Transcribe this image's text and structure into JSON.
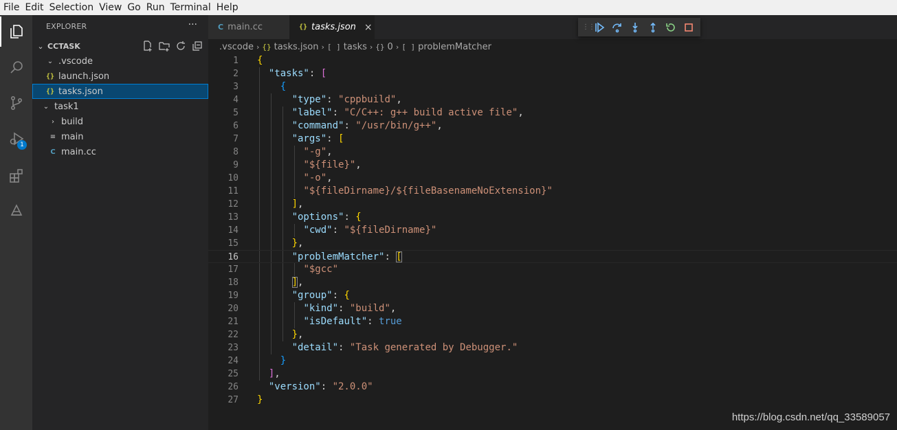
{
  "menu": [
    "File",
    "Edit",
    "Selection",
    "View",
    "Go",
    "Run",
    "Terminal",
    "Help"
  ],
  "activity_bar": {
    "icons": [
      "explorer-icon",
      "search-icon",
      "source-control-icon",
      "run-debug-icon",
      "extensions-icon",
      "remote-icon"
    ],
    "debug_badge": "1"
  },
  "sidebar": {
    "title": "EXPLORER",
    "more": "···",
    "section": "CCTASK",
    "tree": [
      {
        "label": ".vscode",
        "type": "folder-open",
        "depth": 1
      },
      {
        "label": "launch.json",
        "type": "json",
        "depth": 2
      },
      {
        "label": "tasks.json",
        "type": "json",
        "depth": 2,
        "selected": true
      },
      {
        "label": "task1",
        "type": "folder-open",
        "depth": 1
      },
      {
        "label": "build",
        "type": "folder-closed",
        "depth": 2
      },
      {
        "label": "main",
        "type": "file",
        "depth": 2
      },
      {
        "label": "main.cc",
        "type": "cpp",
        "depth": 2
      }
    ]
  },
  "tabs": [
    {
      "label": "main.cc",
      "active": false,
      "icon": "cpp-icon"
    },
    {
      "label": "tasks.json",
      "active": true,
      "icon": "json-icon",
      "close": "×"
    }
  ],
  "breadcrumb": {
    "folder": ".vscode",
    "file": "tasks.json",
    "item1": "tasks",
    "item2": "0",
    "item3": "problemMatcher"
  },
  "editor": {
    "current_line": 16,
    "lines": [
      {
        "n": "1"
      },
      {
        "n": "2"
      },
      {
        "n": "3"
      },
      {
        "n": "4"
      },
      {
        "n": "5"
      },
      {
        "n": "6"
      },
      {
        "n": "7"
      },
      {
        "n": "8"
      },
      {
        "n": "9"
      },
      {
        "n": "10"
      },
      {
        "n": "11"
      },
      {
        "n": "12"
      },
      {
        "n": "13"
      },
      {
        "n": "14"
      },
      {
        "n": "15"
      },
      {
        "n": "16"
      },
      {
        "n": "17"
      },
      {
        "n": "18"
      },
      {
        "n": "19"
      },
      {
        "n": "20"
      },
      {
        "n": "21"
      },
      {
        "n": "22"
      },
      {
        "n": "23"
      },
      {
        "n": "24"
      },
      {
        "n": "25"
      },
      {
        "n": "26"
      },
      {
        "n": "27"
      }
    ],
    "code": {
      "l1_open": "{",
      "tasks_key": "\"tasks\"",
      "type_key": "\"type\"",
      "type_val": "\"cppbuild\"",
      "label_key": "\"label\"",
      "label_val": "\"C/C++: g++ build active file\"",
      "command_key": "\"command\"",
      "command_val": "\"/usr/bin/g++\"",
      "args_key": "\"args\"",
      "arg1": "\"-g\"",
      "arg2": "\"${file}\"",
      "arg3": "\"-o\"",
      "arg4": "\"${fileDirname}/${fileBasenameNoExtension}\"",
      "options_key": "\"options\"",
      "cwd_key": "\"cwd\"",
      "cwd_val": "\"${fileDirname}\"",
      "pm_key": "\"problemMatcher\"",
      "pm_val": "\"$gcc\"",
      "group_key": "\"group\"",
      "kind_key": "\"kind\"",
      "kind_val": "\"build\"",
      "isdefault_key": "\"isDefault\"",
      "isdefault_val": "true",
      "detail_key": "\"detail\"",
      "detail_val": "\"Task generated by Debugger.\"",
      "version_key": "\"version\"",
      "version_val": "\"2.0.0\""
    }
  },
  "watermark": "https://blog.csdn.net/qq_33589057",
  "colors": {
    "accent": "#007acc",
    "selection": "#094771",
    "debug_continue": "#75beff",
    "debug_restart": "#89d185",
    "debug_stop": "#f48771"
  }
}
